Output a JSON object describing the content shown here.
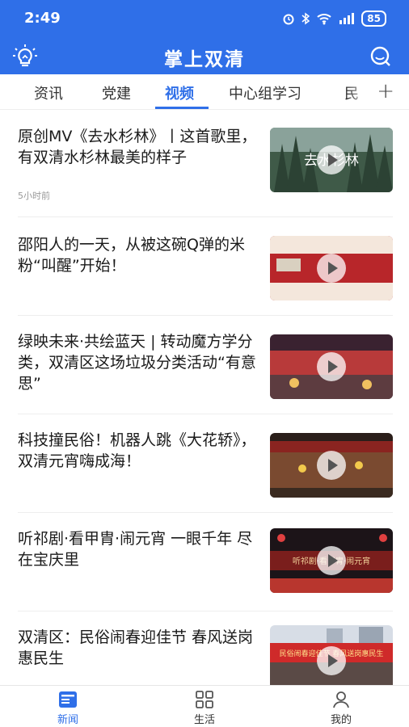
{
  "status_bar": {
    "time": "2:49",
    "icons": [
      "alarm-icon",
      "bluetooth-icon",
      "wifi-icon",
      "signal-icon"
    ],
    "battery": "85"
  },
  "app_bar": {
    "title": "掌上双清",
    "left_icon": "lightbulb-icon",
    "right_icon": "chat-bubble-icon",
    "accent_color": "#2f6fe8"
  },
  "tabs": {
    "items": [
      {
        "label": "资讯"
      },
      {
        "label": "党建"
      },
      {
        "label": "视频"
      },
      {
        "label": "中心组学习"
      },
      {
        "label": "民"
      }
    ],
    "active_index": 2,
    "add_label": "+"
  },
  "news": [
    {
      "title": "原创MV《去水杉林》丨这首歌里，有双清水杉林最美的样子",
      "time": "5小时前",
      "thumb_text": "去水杉林"
    },
    {
      "title": "邵阳人的一天，从被这碗Q弹的米粉“叫醒”开始！",
      "time": "",
      "thumb_text": ""
    },
    {
      "title": "绿映未来·共绘蓝天 | 转动魔方学分类，双清区这场垃圾分类活动“有意思”",
      "time": "",
      "thumb_text": ""
    },
    {
      "title": "科技撞民俗！机器人跳《大花轿》，双清元宵嗨成海！",
      "time": "",
      "thumb_text": ""
    },
    {
      "title": "听祁剧·看甲胄·闹元宵 一眼千年 尽在宝庆里",
      "time": "",
      "thumb_text": "听祁剧·看甲胄·闹元宵"
    },
    {
      "title": "双清区：民俗闹春迎佳节 春风送岗惠民生",
      "time": "",
      "thumb_text": "民俗闹春迎佳节 春风送岗惠民生"
    }
  ],
  "bottom_nav": {
    "items": [
      {
        "label": "新闻",
        "icon": "news-icon",
        "active": true
      },
      {
        "label": "生活",
        "icon": "grid-icon",
        "active": false
      },
      {
        "label": "我的",
        "icon": "person-icon",
        "active": false
      }
    ]
  }
}
